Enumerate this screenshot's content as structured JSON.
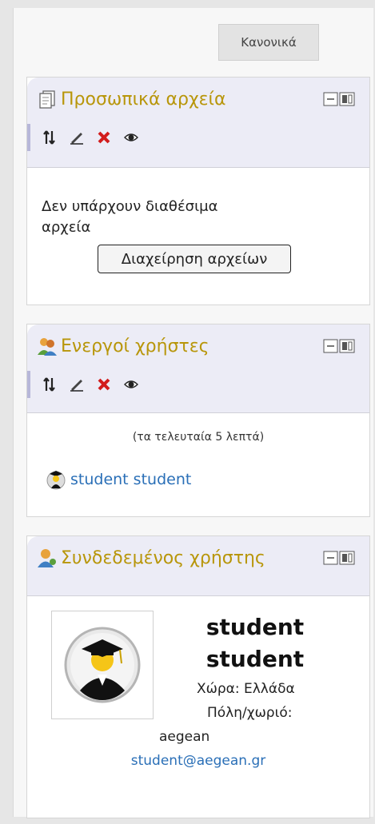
{
  "normal_button": "Κανονικά",
  "blocks": {
    "files": {
      "title": "Προσωπικά αρχεία",
      "empty_line1": "Δεν υπάρχουν διαθέσιμα",
      "empty_line2": "αρχεία",
      "manage_button": "Διαχείρηση αρχείων"
    },
    "online": {
      "title": "Ενεργοί χρήστες",
      "note": "(τα τελευταία 5 λεπτά)",
      "users": [
        "student student"
      ]
    },
    "logged": {
      "title": "Συνδεδεμένος χρήστης",
      "name_line1": "student",
      "name_line2": "student",
      "country": "Χώρα: Ελλάδα",
      "city_label": "Πόλη/χωριό:",
      "city_value": "aegean",
      "email": "student@aegean.gr"
    }
  },
  "icons": {
    "toolbar": [
      "move-icon",
      "edit-icon",
      "delete-icon",
      "hide-icon"
    ],
    "collapse": "dock-collapse-icon"
  },
  "colors": {
    "title": "#b8960a",
    "link": "#2a6fb7",
    "header_bg": "#ececf6",
    "delete": "#d21c1c"
  }
}
